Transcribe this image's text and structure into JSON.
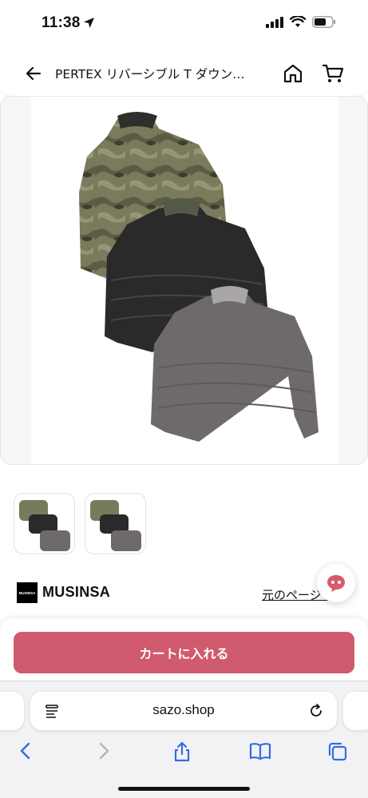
{
  "status_bar": {
    "time": "11:38"
  },
  "header": {
    "title": "PERTEX リバーシブル T ダウン…"
  },
  "product": {
    "image_alt": "jackets",
    "thumbnail_count": 2
  },
  "brand": {
    "logo_text": "MUSINSA",
    "name": "MUSINSA",
    "original_link": "元のページへ"
  },
  "cta": {
    "add_to_cart": "カートに入れる",
    "color": "#d05a6e"
  },
  "browser": {
    "url": "sazo.shop"
  },
  "colors": {
    "accent": "#d05a6e",
    "link_blue": "#2f6fe0"
  },
  "icons": [
    "location-arrow-icon",
    "signal-icon",
    "wifi-icon",
    "battery-icon",
    "back-arrow-icon",
    "home-icon",
    "cart-icon",
    "chat-icon",
    "reader-icon",
    "reload-icon",
    "browser-back-icon",
    "browser-forward-icon",
    "share-icon",
    "bookmarks-icon",
    "tabs-icon"
  ]
}
